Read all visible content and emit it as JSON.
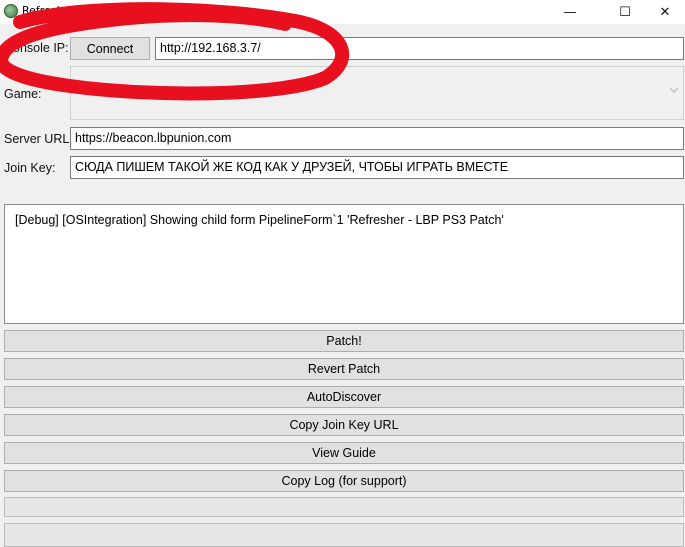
{
  "window": {
    "title": "Refresher - LBP PS3 Patch",
    "controls": {
      "minimize": "—",
      "maximize": "☐",
      "close": "✕"
    }
  },
  "console_ip": {
    "label": "Console IP:",
    "connect_label": "Connect",
    "value": "http://192.168.3.7/"
  },
  "game": {
    "label": "Game:",
    "value": "",
    "dropdown_icon": "chevron-down-icon"
  },
  "server_url": {
    "label": "Server URL:",
    "value": "https://beacon.lbpunion.com"
  },
  "join_key": {
    "label": "Join Key:",
    "value": "СЮДА ПИШЕМ ТАКОЙ ЖЕ КОД КАК У ДРУЗЕЙ, ЧТОБЫ ИГРАТЬ ВМЕСТЕ"
  },
  "log": {
    "lines": [
      "[Debug] [OSIntegration] Showing child form PipelineForm`1 'Refresher - LBP PS3 Patch'"
    ]
  },
  "buttons": {
    "patch": "Patch!",
    "revert": "Revert Patch",
    "autodiscover": "AutoDiscover",
    "copy_join_key_url": "Copy Join Key URL",
    "view_guide": "View Guide",
    "copy_log": "Copy Log (for support)"
  },
  "colors": {
    "annotation_red": "#e8101e",
    "window_bg": "#f0f0f0",
    "button_bg": "#e1e1e1"
  }
}
